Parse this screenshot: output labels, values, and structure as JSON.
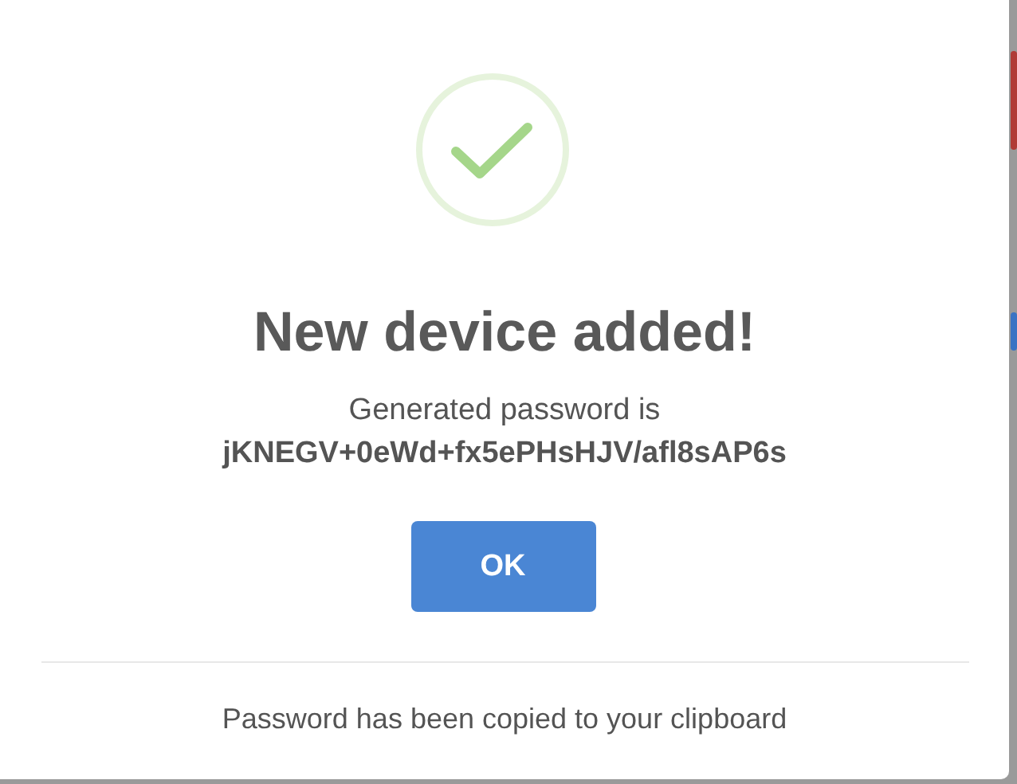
{
  "dialog": {
    "title": "New device added!",
    "message": "Generated password is",
    "password": "jKNEGV+0eWd+fx5ePHsHJV/afl8sAP6s",
    "buttons": [
      "OK"
    ],
    "footer": "Password has been copied to your clipboard"
  }
}
